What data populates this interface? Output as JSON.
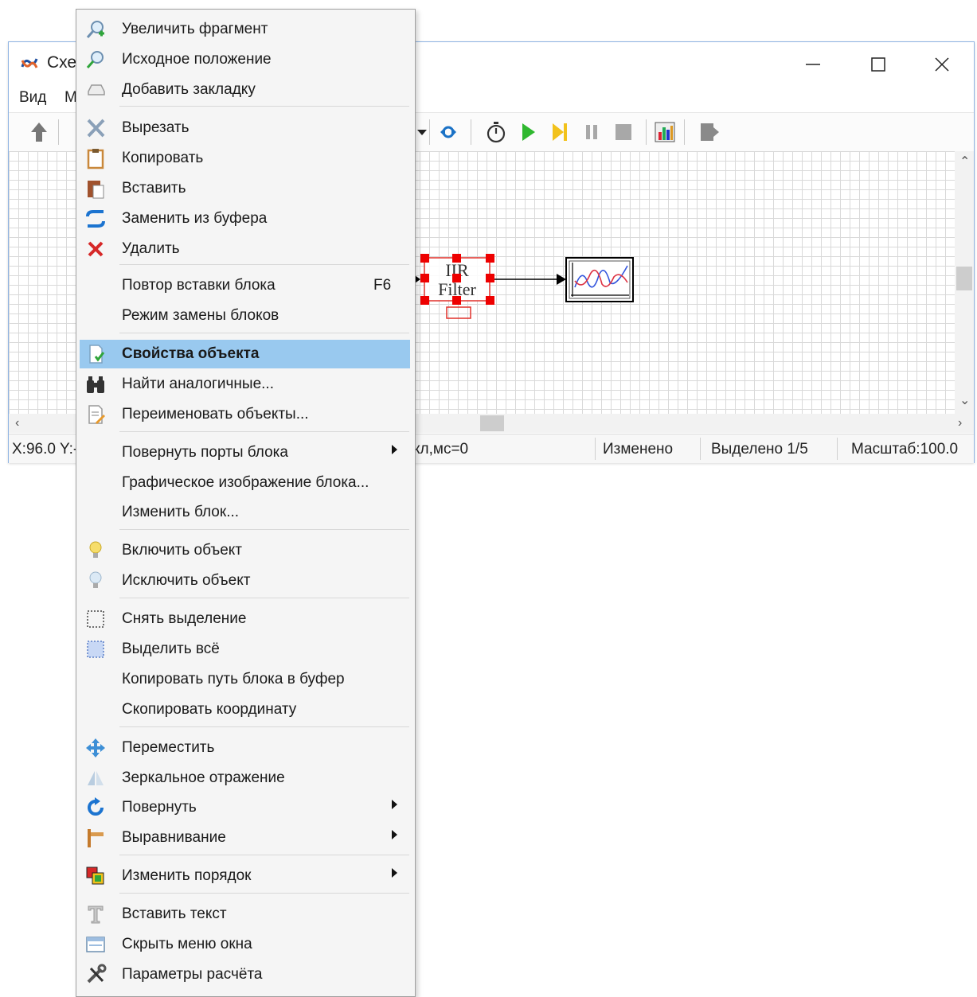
{
  "window": {
    "title": "Схе",
    "menu": [
      "Вид",
      "М"
    ]
  },
  "status": {
    "x": "X:96.0",
    "y": "Y:-",
    "step": "кл,мс=0",
    "modified": "Изменено",
    "selected": "Выделено 1/5",
    "scale": "Масштаб:100.0"
  },
  "diagram": {
    "block_title_1": "IIR",
    "block_title_2": "Filter"
  },
  "context_menu": {
    "items": [
      {
        "label": "Увеличить фрагмент",
        "icon": "zoom-in-icon"
      },
      {
        "label": "Исходное положение",
        "icon": "home-position-icon"
      },
      {
        "label": "Добавить закладку",
        "icon": "bookmark-icon"
      },
      {
        "label": "Вырезать",
        "icon": "cut-icon"
      },
      {
        "label": "Копировать",
        "icon": "copy-icon"
      },
      {
        "label": "Вставить",
        "icon": "paste-icon"
      },
      {
        "label": "Заменить из буфера",
        "icon": "replace-icon"
      },
      {
        "label": "Удалить",
        "icon": "delete-icon"
      },
      {
        "label": "Повтор вставки блока",
        "shortcut": "F6"
      },
      {
        "label": "Режим замены блоков"
      },
      {
        "label": "Свойства объекта",
        "icon": "properties-icon",
        "highlighted": true
      },
      {
        "label": "Найти аналогичные...",
        "icon": "binoculars-icon"
      },
      {
        "label": "Переименовать объекты...",
        "icon": "rename-icon"
      },
      {
        "label": "Повернуть порты блока",
        "submenu": true
      },
      {
        "label": "Графическое изображение блока..."
      },
      {
        "label": "Изменить блок..."
      },
      {
        "label": "Включить объект",
        "icon": "bulb-on-icon"
      },
      {
        "label": "Исключить объект",
        "icon": "bulb-off-icon"
      },
      {
        "label": "Снять выделение",
        "icon": "deselect-icon"
      },
      {
        "label": "Выделить всё",
        "icon": "select-all-icon"
      },
      {
        "label": "Копировать путь блока в буфер"
      },
      {
        "label": "Скопировать координату"
      },
      {
        "label": "Переместить",
        "icon": "move-icon"
      },
      {
        "label": "Зеркальное отражение",
        "icon": "mirror-icon"
      },
      {
        "label": "Повернуть",
        "icon": "rotate-icon",
        "submenu": true
      },
      {
        "label": "Выравнивание",
        "icon": "align-icon",
        "submenu": true
      },
      {
        "label": "Изменить порядок",
        "icon": "order-icon",
        "submenu": true
      },
      {
        "label": "Вставить текст",
        "icon": "text-icon"
      },
      {
        "label": "Скрыть меню окна",
        "icon": "hide-menu-icon"
      },
      {
        "label": "Параметры расчёта",
        "icon": "tools-icon"
      }
    ]
  }
}
